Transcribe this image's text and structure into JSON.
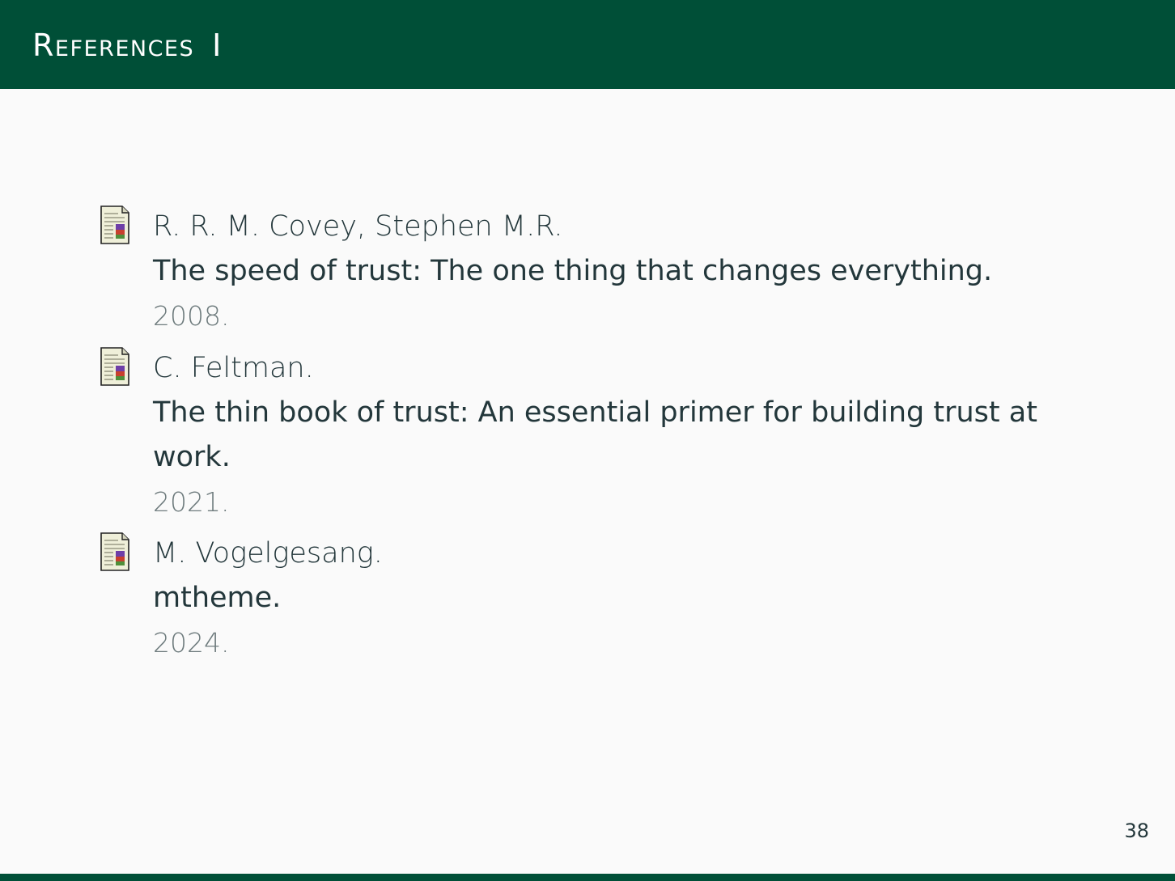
{
  "header": {
    "title": "References",
    "title_number": "I"
  },
  "references": [
    {
      "author": "R. R. M. Covey, Stephen M.R.",
      "title": "The speed of trust: The one thing that changes everything.",
      "year": "2008.",
      "icon": "document-icon"
    },
    {
      "author": "C. Feltman.",
      "title_line1": "The thin book of trust: An essential primer for building trust at",
      "title_line2": "work.",
      "year": "2021.",
      "icon": "document-icon"
    },
    {
      "author": "M. Vogelgesang.",
      "title": "mtheme.",
      "year": "2024.",
      "icon": "document-icon"
    }
  ],
  "page_number": "38",
  "colors": {
    "accent": "#004f37",
    "background": "#fafafa",
    "text": "#23373b",
    "muted_text": "#6e7b7d"
  }
}
